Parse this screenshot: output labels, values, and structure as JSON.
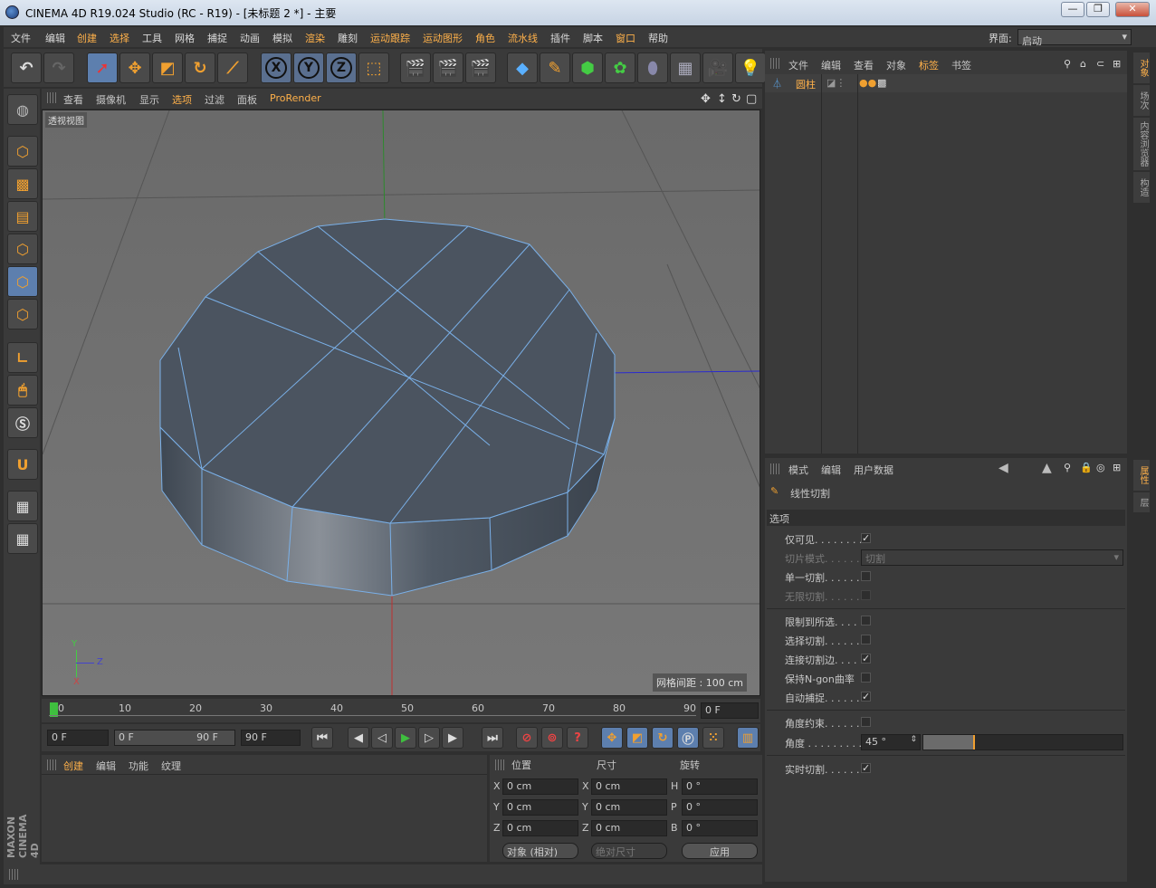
{
  "window": {
    "title": "CINEMA 4D R19.024 Studio (RC - R19) - [未标题 2 *] - 主要",
    "min": "—",
    "max": "❐",
    "close": "✕"
  },
  "menu": {
    "items": [
      "文件",
      "编辑",
      "创建",
      "选择",
      "工具",
      "网格",
      "捕捉",
      "动画",
      "模拟",
      "渲染",
      "雕刻",
      "运动跟踪",
      "运动图形",
      "角色",
      "流水线",
      "插件",
      "脚本",
      "窗口",
      "帮助"
    ],
    "layout_label": "界面:",
    "layout_value": "启动"
  },
  "toolbar": {
    "axis_x": "X",
    "axis_y": "Y",
    "axis_z": "Z"
  },
  "viewport": {
    "menu": [
      "查看",
      "摄像机",
      "显示",
      "选项",
      "过滤",
      "面板",
      "ProRender"
    ],
    "label": "透视视图",
    "grid_info": "网格间距 : 100 cm",
    "axis_y": "Y",
    "axis_z": "Z",
    "axis_x": "X"
  },
  "object_manager": {
    "menu": [
      "文件",
      "编辑",
      "查看",
      "对象",
      "标签",
      "书签"
    ],
    "object_name": "圆柱"
  },
  "attribute_manager": {
    "menu": [
      "模式",
      "编辑",
      "用户数据"
    ],
    "tool_name": "线性切割",
    "section": "选项",
    "rows": [
      {
        "label": "仅可见. . . . . . . . .",
        "checked": "✓",
        "dim": false
      },
      {
        "label": "切片模式. . . . . . .",
        "value": "切割",
        "dim": true
      },
      {
        "label": "单一切割. . . . . . .",
        "checked": "",
        "dim": false
      },
      {
        "label": "无限切割. . . . . . .",
        "checked": "",
        "dim": true
      },
      {
        "label": "限制到所选. . . . .",
        "checked": "",
        "dim": false
      },
      {
        "label": "选择切割. . . . . . .",
        "checked": "",
        "dim": false
      },
      {
        "label": "连接切割边. . . . .",
        "checked": "✓",
        "dim": false
      },
      {
        "label": "保持N-gon曲率",
        "checked": "",
        "dim": false
      },
      {
        "label": "自动捕捉. . . . . . .",
        "checked": "✓",
        "dim": false
      },
      {
        "label": "角度约束. . . . . . .",
        "checked": "",
        "dim": false
      },
      {
        "label": "角度 . . . . . . . . . .",
        "value": "45 °",
        "dim": false
      },
      {
        "label": "实时切割. . . . . . .",
        "checked": "✓",
        "dim": false
      }
    ]
  },
  "side_tabs": [
    "对象",
    "场次",
    "内容浏览器",
    "构造",
    "属性",
    "层"
  ],
  "timeline": {
    "ticks": [
      "0",
      "10",
      "20",
      "30",
      "40",
      "50",
      "60",
      "70",
      "80",
      "90"
    ],
    "current": "0 F"
  },
  "playback": {
    "start": "0 F",
    "range_start": "0 F",
    "range_end": "90 F",
    "end": "90 F"
  },
  "material_manager": {
    "menu": [
      "创建",
      "编辑",
      "功能",
      "纹理"
    ]
  },
  "coordinates": {
    "headers": [
      "位置",
      "尺寸",
      "旋转"
    ],
    "pos": [
      {
        "axis": "X",
        "value": "0 cm"
      },
      {
        "axis": "Y",
        "value": "0 cm"
      },
      {
        "axis": "Z",
        "value": "0 cm"
      }
    ],
    "size": [
      {
        "axis": "X",
        "value": "0 cm"
      },
      {
        "axis": "Y",
        "value": "0 cm"
      },
      {
        "axis": "Z",
        "value": "0 cm"
      }
    ],
    "rot": [
      {
        "axis": "H",
        "value": "0 °"
      },
      {
        "axis": "P",
        "value": "0 °"
      },
      {
        "axis": "B",
        "value": "0 °"
      }
    ],
    "mode": "对象 (相对)",
    "size_mode": "绝对尺寸",
    "apply": "应用"
  },
  "branding": "MAXON CINEMA 4D",
  "colors": {
    "accent": "#ffb14a",
    "selected": "#5d7fae"
  }
}
